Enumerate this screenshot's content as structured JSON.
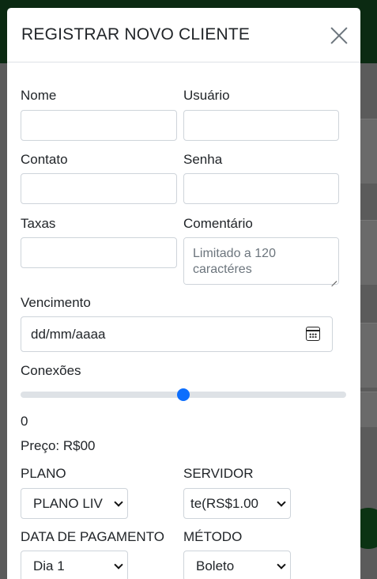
{
  "modal": {
    "title": "REGISTRAR NOVO CLIENTE"
  },
  "form": {
    "nome_label": "Nome",
    "usuario_label": "Usuário",
    "contato_label": "Contato",
    "senha_label": "Senha",
    "taxas_label": "Taxas",
    "comentario_label": "Comentário",
    "comentario_placeholder": "Limitado a 120 caractéres",
    "vencimento_label": "Vencimento",
    "vencimento_value": "dd/mm/aaaa",
    "conexoes_label": "Conexões",
    "conexoes_slider_fraction": 0.5,
    "conexoes_value": "0",
    "preco_text": "Preço: R$00",
    "plano_label": "PLANO",
    "plano_value": "PLANO LIV",
    "servidor_label": "SERVIDOR",
    "servidor_value": "te(RS$1.00",
    "data_pagamento_label": "DATA DE PAGAMENTO",
    "data_pagamento_value": "Dia 1",
    "metodo_label": "MÉTODO",
    "metodo_value": "Boleto"
  },
  "colors": {
    "accent": "#0d6efd",
    "topbar": "#0b2a12",
    "overlay": "#5b5b5b"
  },
  "icons": {
    "close": "close-icon",
    "calendar": "calendar-icon",
    "select": "chevron-down-icon"
  }
}
